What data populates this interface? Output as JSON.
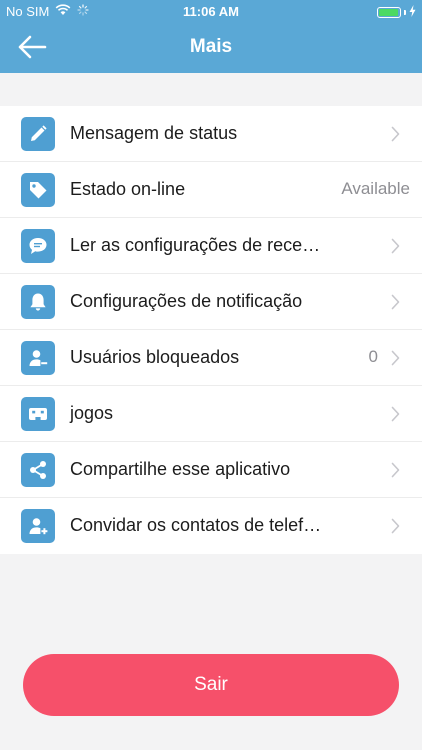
{
  "status_bar": {
    "carrier": "No SIM",
    "time": "11:06 AM"
  },
  "nav": {
    "title": "Mais"
  },
  "menu": {
    "items": [
      {
        "label": "Mensagem de status",
        "value": "",
        "icon": "pencil-icon"
      },
      {
        "label": "Estado on-line",
        "value": "Available",
        "icon": "tag-icon"
      },
      {
        "label": "Ler as configurações de rece…",
        "value": "",
        "icon": "chat-bubble-icon"
      },
      {
        "label": "Configurações de notificação",
        "value": "",
        "icon": "bell-icon"
      },
      {
        "label": "Usuários bloqueados",
        "value": "0",
        "icon": "blocked-user-icon"
      },
      {
        "label": "jogos",
        "value": "",
        "icon": "gamepad-icon"
      },
      {
        "label": "Compartilhe esse aplicativo",
        "value": "",
        "icon": "share-icon"
      },
      {
        "label": "Convidar os contatos de telef…",
        "value": "",
        "icon": "add-contact-icon"
      }
    ]
  },
  "logout": {
    "label": "Sair"
  },
  "colors": {
    "header": "#5aa8d6",
    "icon_background": "#4f9fd2",
    "logout_button": "#f6506a",
    "page_background": "#f3f3f4"
  }
}
